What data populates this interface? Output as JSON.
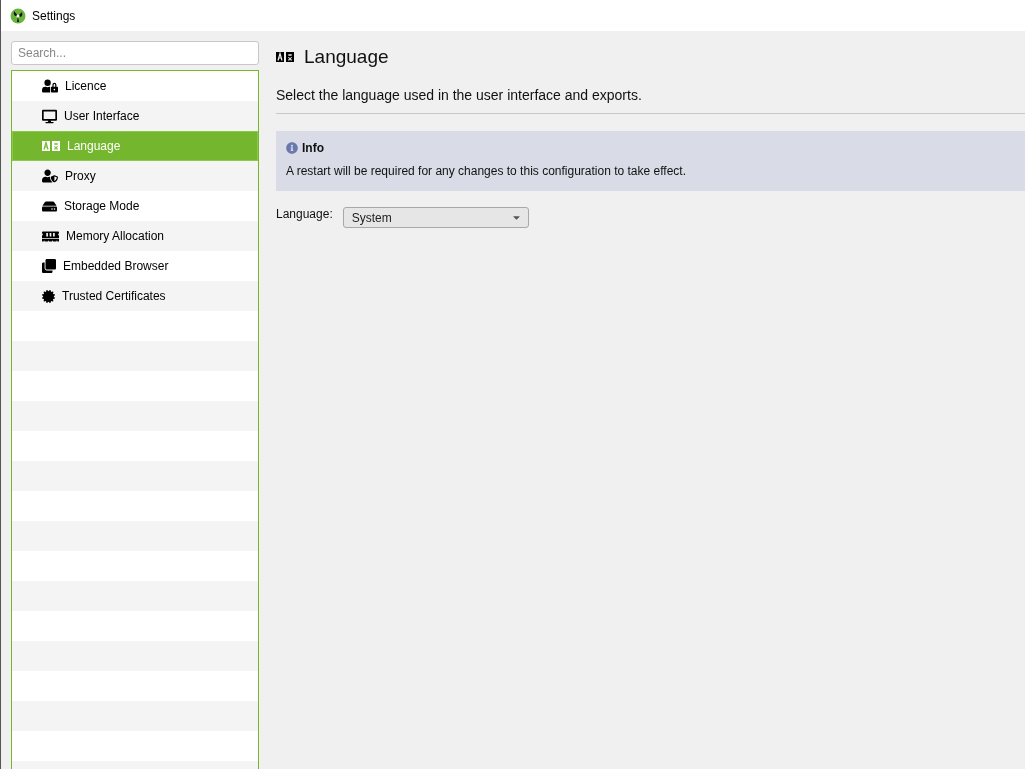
{
  "window": {
    "title": "Settings"
  },
  "sidebar": {
    "search": {
      "placeholder": "Search..."
    },
    "items": [
      {
        "label": "Licence",
        "selected": false
      },
      {
        "label": "User Interface",
        "selected": false
      },
      {
        "label": "Language",
        "selected": true
      },
      {
        "label": "Proxy",
        "selected": false
      },
      {
        "label": "Storage Mode",
        "selected": false
      },
      {
        "label": "Memory Allocation",
        "selected": false
      },
      {
        "label": "Embedded Browser",
        "selected": false
      },
      {
        "label": "Trusted Certificates",
        "selected": false
      }
    ]
  },
  "content": {
    "title": "Language",
    "description": "Select the language used in the user interface and exports.",
    "info": {
      "title": "Info",
      "text": "A restart will be required for any changes to this configuration to take effect."
    },
    "fields": [
      {
        "label": "Language:",
        "value": "System"
      }
    ]
  }
}
